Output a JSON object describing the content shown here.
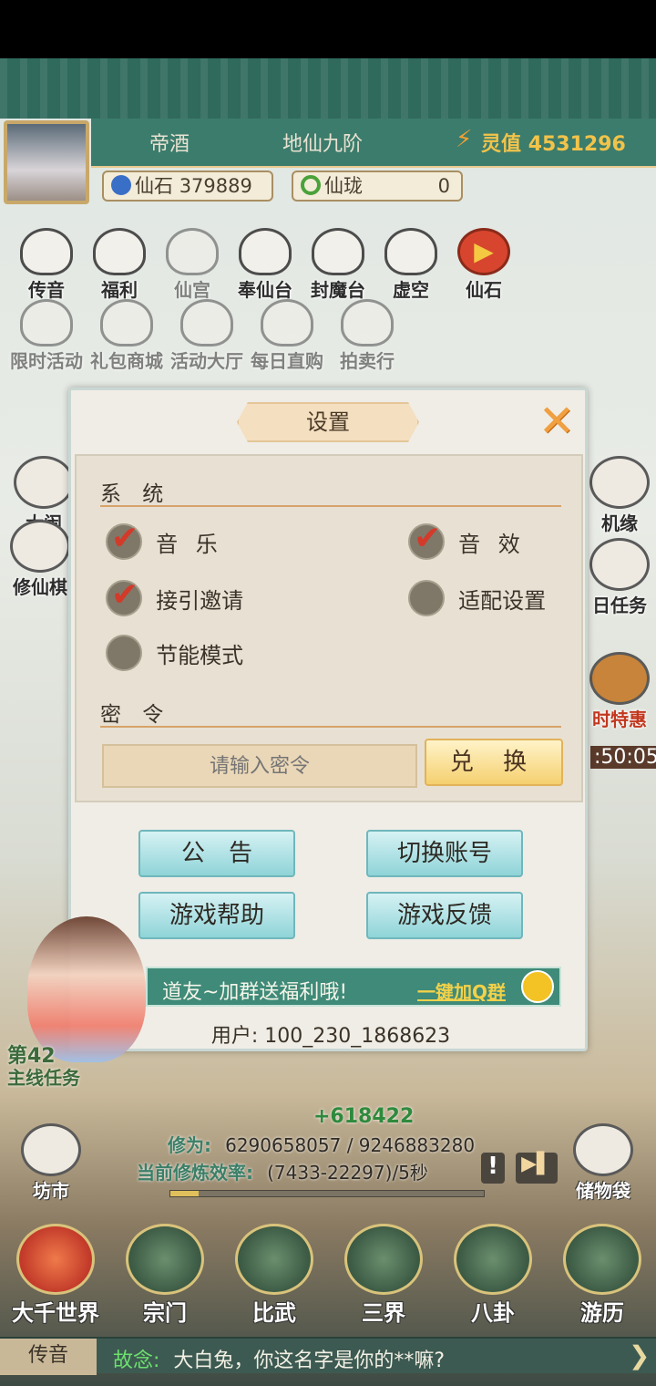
{
  "header": {
    "player_name": "帝酒",
    "rank": "地仙九阶",
    "lingzhi_label": "灵值",
    "lingzhi_value": "4531296",
    "xianshi_label": "仙石",
    "xianshi_value": "379889",
    "xianlong_label": "仙珑",
    "xianlong_value": "0"
  },
  "top_icons_row1": [
    {
      "label": "传音",
      "icon": "envelope-icon"
    },
    {
      "label": "福利",
      "icon": "gift-icon"
    },
    {
      "label": "仙宫",
      "icon": "palace-icon"
    },
    {
      "label": "奉仙台",
      "icon": "altar-icon"
    },
    {
      "label": "封魔台",
      "icon": "seal-icon"
    },
    {
      "label": "虚空",
      "icon": "void-icon"
    },
    {
      "label": "仙石",
      "icon": "play-icon"
    }
  ],
  "top_icons_row2": [
    {
      "label": "限时活动",
      "icon": "timer-icon"
    },
    {
      "label": "礼包商城",
      "icon": "shop-icon"
    },
    {
      "label": "活动大厅",
      "icon": "hall-icon"
    },
    {
      "label": "每日直购",
      "icon": "coin-icon"
    },
    {
      "label": "拍卖行",
      "icon": "hammer-icon"
    }
  ],
  "left_side": [
    {
      "label": "大闹",
      "icon": "gate-icon"
    },
    {
      "label": "修仙棋",
      "icon": "turtle-icon"
    }
  ],
  "right_side": [
    {
      "label": "机缘",
      "icon": "fortune-icon"
    },
    {
      "label": "日任务",
      "icon": "book-icon"
    },
    {
      "label": "时特惠",
      "icon": "treasure-icon"
    },
    {
      "label": ":50:05",
      "icon": ""
    }
  ],
  "dialog": {
    "title": "设置",
    "section_system": "系 统",
    "options": [
      {
        "label": "音 乐",
        "checked": true
      },
      {
        "label": "音 效",
        "checked": true
      },
      {
        "label": "接引邀请",
        "checked": true
      },
      {
        "label": "适配设置",
        "checked": false
      },
      {
        "label": "节能模式",
        "checked": false
      }
    ],
    "section_password": "密 令",
    "password_placeholder": "请输入密令",
    "redeem_label": "兑 换",
    "btn_notice": "公　告",
    "btn_switch_account": "切换账号",
    "btn_help": "游戏帮助",
    "btn_feedback": "游戏反馈",
    "group_text": "道友~加群送福利哦!",
    "group_link": "一键加Q群",
    "user_label": "用户: 100_230_1868623"
  },
  "quest": {
    "chapter": "第42",
    "label": "主线任务"
  },
  "cultivation": {
    "gain": "+618422",
    "xiuwei_label": "修为:",
    "xiuwei_value": "6290658057 / 9246883280",
    "rate_label": "当前修炼效率:",
    "rate_value": "(7433-22297)/5秒",
    "progress": 0.09
  },
  "side_buttons": {
    "market": "坊市",
    "bag": "储物袋"
  },
  "bottom_nav": [
    {
      "label": "大千世界",
      "active": true
    },
    {
      "label": "宗门",
      "active": false
    },
    {
      "label": "比武",
      "active": false
    },
    {
      "label": "三界",
      "active": false
    },
    {
      "label": "八卦",
      "active": false
    },
    {
      "label": "游历",
      "active": false
    }
  ],
  "chat": {
    "tab": "传音",
    "sender": "故念:",
    "message": "大白兔，你这名字是你的**嘛?"
  },
  "colors": {
    "accent_teal": "#3f8a78",
    "gold": "#f2c34a",
    "check_red": "#d33a2a"
  }
}
